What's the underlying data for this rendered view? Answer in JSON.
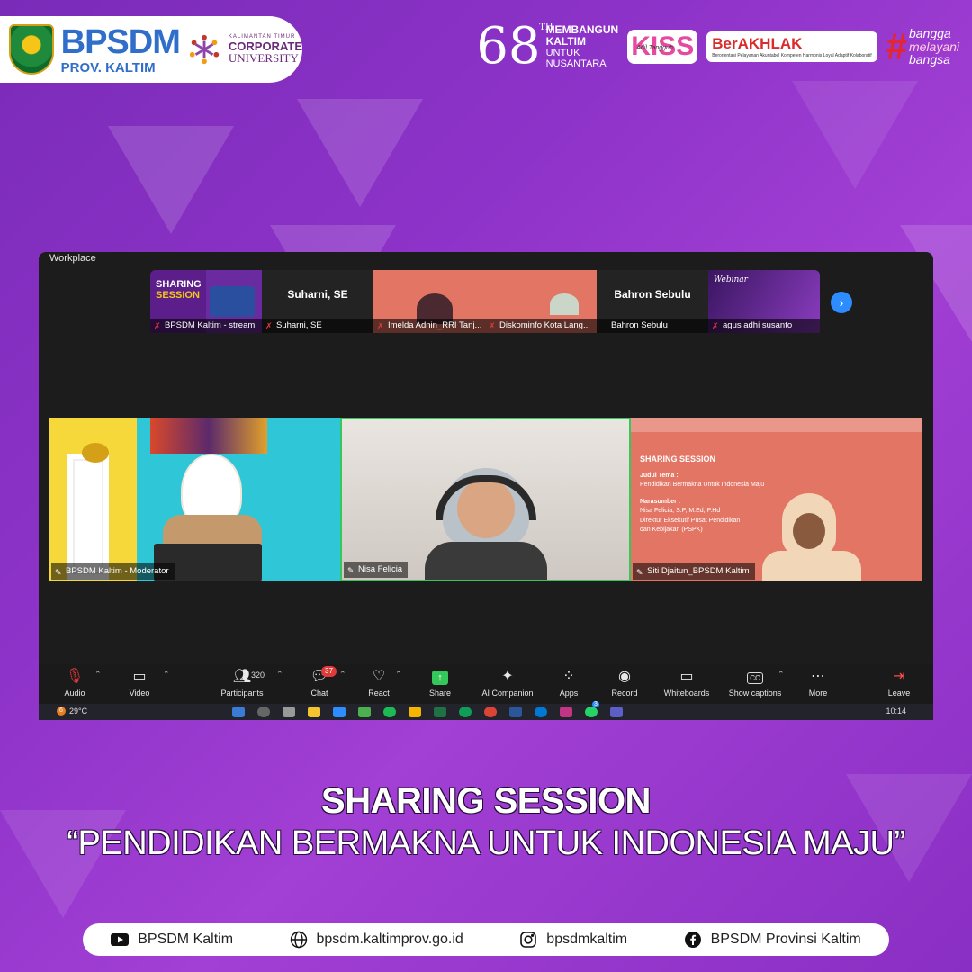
{
  "header": {
    "logo_bpsdm": "BPSDM",
    "logo_prov": "PROV. KALTIM",
    "cu_small": "KALIMANTAN TIMUR",
    "cu_main": "CORPORATE",
    "cu_uni": "UNIVERSITY",
    "anniv_number": "68",
    "anniv_th": "TH",
    "anniv_line1": "MEMBANGUN",
    "anniv_line2": "KALTIM",
    "anniv_line3": "UNTUK",
    "anniv_line4": "NUSANTARA",
    "kiss": "KISS",
    "kiss_sub": "Adil Tangguh",
    "berakhlak": "BerAKHLAK",
    "berakhlak_sub": "Berorientasi Pelayanan Akuntabel Kompeten Harmonis Loyal Adaptif Kolaboratif",
    "bangga_hash": "#",
    "bangga_1": "bangga",
    "bangga_2": "melayani",
    "bangga_3": "bangsa"
  },
  "zoom": {
    "window_title": "Workplace",
    "strip": [
      {
        "name": "BPSDM Kaltim - stream",
        "kind": "sharing",
        "line1": "SHARING",
        "line2": "SESSION"
      },
      {
        "name": "Suharni, SE",
        "kind": "dark",
        "big": "Suharni, SE"
      },
      {
        "name": "Imelda Adnin_RRI Tanj...",
        "kind": "salmon"
      },
      {
        "name": "Diskominfo Kota Lang...",
        "kind": "salmon"
      },
      {
        "name": "Bahron Sebulu",
        "kind": "dark",
        "big": "Bahron Sebulu"
      },
      {
        "name": "agus adhi susanto",
        "kind": "webinar",
        "big": "Webinar"
      }
    ],
    "gallery": [
      {
        "name": "BPSDM Kaltim - Moderator"
      },
      {
        "name": "Nisa Felicia"
      },
      {
        "name": "Siti Djaitun_BPSDM Kaltim"
      }
    ],
    "slide": {
      "title": "SHARING SESSION",
      "judul_label": "Judul Tema :",
      "judul": "Pendidikan Bermakna Untuk Indonesia Maju",
      "nara_label": "Narasumber :",
      "nara": "Nisa Felicia, S.P, M.Ed, P.Hd",
      "nara_role": "Direktur Eksekutif Pusat Pendidikan dan Kebijakan (PSPK)"
    },
    "toolbar": {
      "audio": "Audio",
      "video": "Video",
      "participants": "Participants",
      "participants_count": "320",
      "chat": "Chat",
      "chat_badge": "37",
      "react": "React",
      "share": "Share",
      "ai": "AI Companion",
      "apps": "Apps",
      "record": "Record",
      "whiteboards": "Whiteboards",
      "captions": "Show captions",
      "more": "More",
      "leave": "Leave"
    },
    "taskbar": {
      "weather_badge": "6",
      "temp": "29°C",
      "time": "10:14",
      "notif_badge": "3"
    }
  },
  "caption": {
    "title": "SHARING SESSION",
    "subtitle": "“PENDIDIKAN BERMAKNA UNTUK INDONESIA MAJU”"
  },
  "footer": {
    "youtube": "BPSDM Kaltim",
    "website": "bpsdm.kaltimprov.go.id",
    "instagram": "bpsdmkaltim",
    "facebook": "BPSDM Provinsi Kaltim"
  },
  "colors": {
    "bg_purple": "#8e33c9",
    "zoom_green": "#35c759",
    "zoom_blue": "#2d8cff",
    "slide_salmon": "#e37565"
  }
}
